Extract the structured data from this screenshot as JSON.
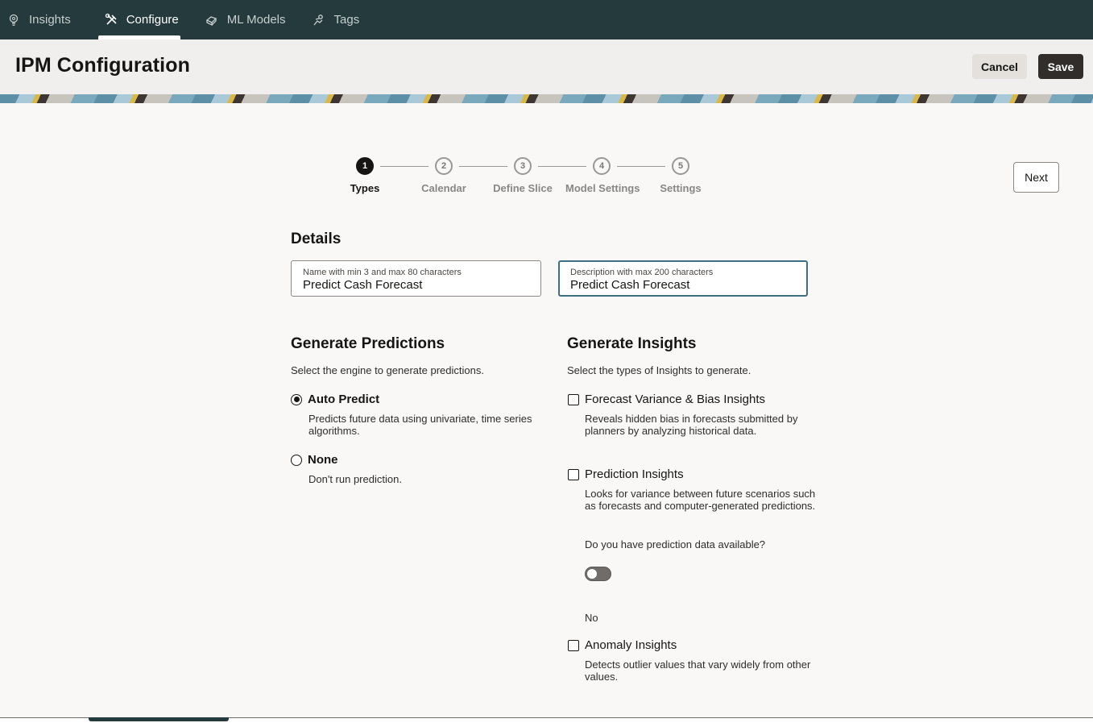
{
  "nav": {
    "tabs": [
      {
        "label": "Insights",
        "icon": "lightbulb-icon"
      },
      {
        "label": "Configure",
        "icon": "tools-icon",
        "active": true
      },
      {
        "label": "ML Models",
        "icon": "model-icon"
      },
      {
        "label": "Tags",
        "icon": "tag-icon"
      }
    ]
  },
  "header": {
    "title": "IPM Configuration",
    "cancel_label": "Cancel",
    "save_label": "Save"
  },
  "train": {
    "steps": [
      {
        "number": "1",
        "label": "Types",
        "current": true
      },
      {
        "number": "2",
        "label": "Calendar"
      },
      {
        "number": "3",
        "label": "Define Slice"
      },
      {
        "number": "4",
        "label": "Model Settings"
      },
      {
        "number": "5",
        "label": "Settings"
      }
    ],
    "next_label": "Next"
  },
  "details": {
    "heading": "Details",
    "name_label": "Name with min 3 and max 80 characters",
    "name_value": "Predict Cash Forecast",
    "description_label": "Description with max 200 characters",
    "description_value": "Predict Cash Forecast"
  },
  "predictions": {
    "heading": "Generate Predictions",
    "description": "Select the engine to generate predictions.",
    "options": [
      {
        "label": "Auto Predict",
        "description": "Predicts future data using univariate, time series algorithms.",
        "selected": true
      },
      {
        "label": "None",
        "description": "Don't run prediction.",
        "selected": false
      }
    ]
  },
  "insights": {
    "heading": "Generate Insights",
    "description": "Select the types of Insights to generate.",
    "options": [
      {
        "label": "Forecast Variance & Bias Insights",
        "description": "Reveals hidden bias in forecasts submitted by planners by analyzing historical data.",
        "checked": false
      },
      {
        "label": "Prediction Insights",
        "description": "Looks for variance between future scenarios such as forecasts and computer-generated predictions.",
        "checked": false
      },
      {
        "label": "Anomaly Insights",
        "description": "Detects outlier values that vary widely from other values.",
        "checked": false
      }
    ],
    "prediction_question": "Do you have prediction data available?",
    "prediction_toggle_state": "No"
  },
  "colors": {
    "nav_bg": "#243a3d",
    "header_bg": "#f1efed",
    "primary_button": "#312d2a",
    "focus_border": "#3e6f83"
  }
}
